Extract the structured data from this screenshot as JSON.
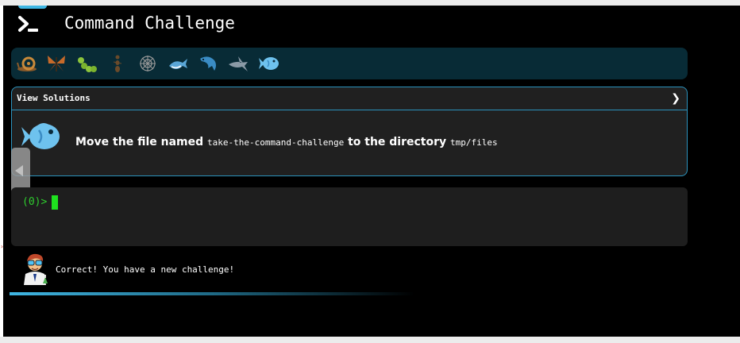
{
  "app": {
    "title": "Command Challenge"
  },
  "levels": [
    {
      "name": "snail",
      "icon": "snail-icon",
      "color": "#c98a3a"
    },
    {
      "name": "butterfly",
      "icon": "butterfly-icon",
      "color": "#c76a2a"
    },
    {
      "name": "caterpillar",
      "icon": "caterpillar-icon",
      "color": "#8cc43c"
    },
    {
      "name": "ant",
      "icon": "ant-icon",
      "color": "#6a4a2a"
    },
    {
      "name": "spider-web",
      "icon": "spider-web-icon",
      "color": "#aaaaaa"
    },
    {
      "name": "whale",
      "icon": "whale-icon",
      "color": "#5aa6d6"
    },
    {
      "name": "dolphin",
      "icon": "dolphin-icon",
      "color": "#3a8cc4"
    },
    {
      "name": "shark",
      "icon": "shark-icon",
      "color": "#8a9aa6"
    },
    {
      "name": "fish",
      "icon": "fish-icon",
      "color": "#6ec2ee",
      "active": true
    }
  ],
  "challenge": {
    "solutions_label": "View Solutions",
    "task_prefix": "Move the file named ",
    "task_file": "take-the-command-challenge",
    "task_middle": " to the directory ",
    "task_dir": "tmp/files",
    "icon": "fish-icon"
  },
  "terminal": {
    "prompt": "(0)>"
  },
  "feedback": {
    "message": "Correct! You have a new challenge!",
    "mascot": "scientist-mascot-icon"
  },
  "progress": {
    "fraction": 0.55
  },
  "colors": {
    "accent": "#2b93bd",
    "prompt": "#2ecc2e",
    "background": "#000000"
  }
}
